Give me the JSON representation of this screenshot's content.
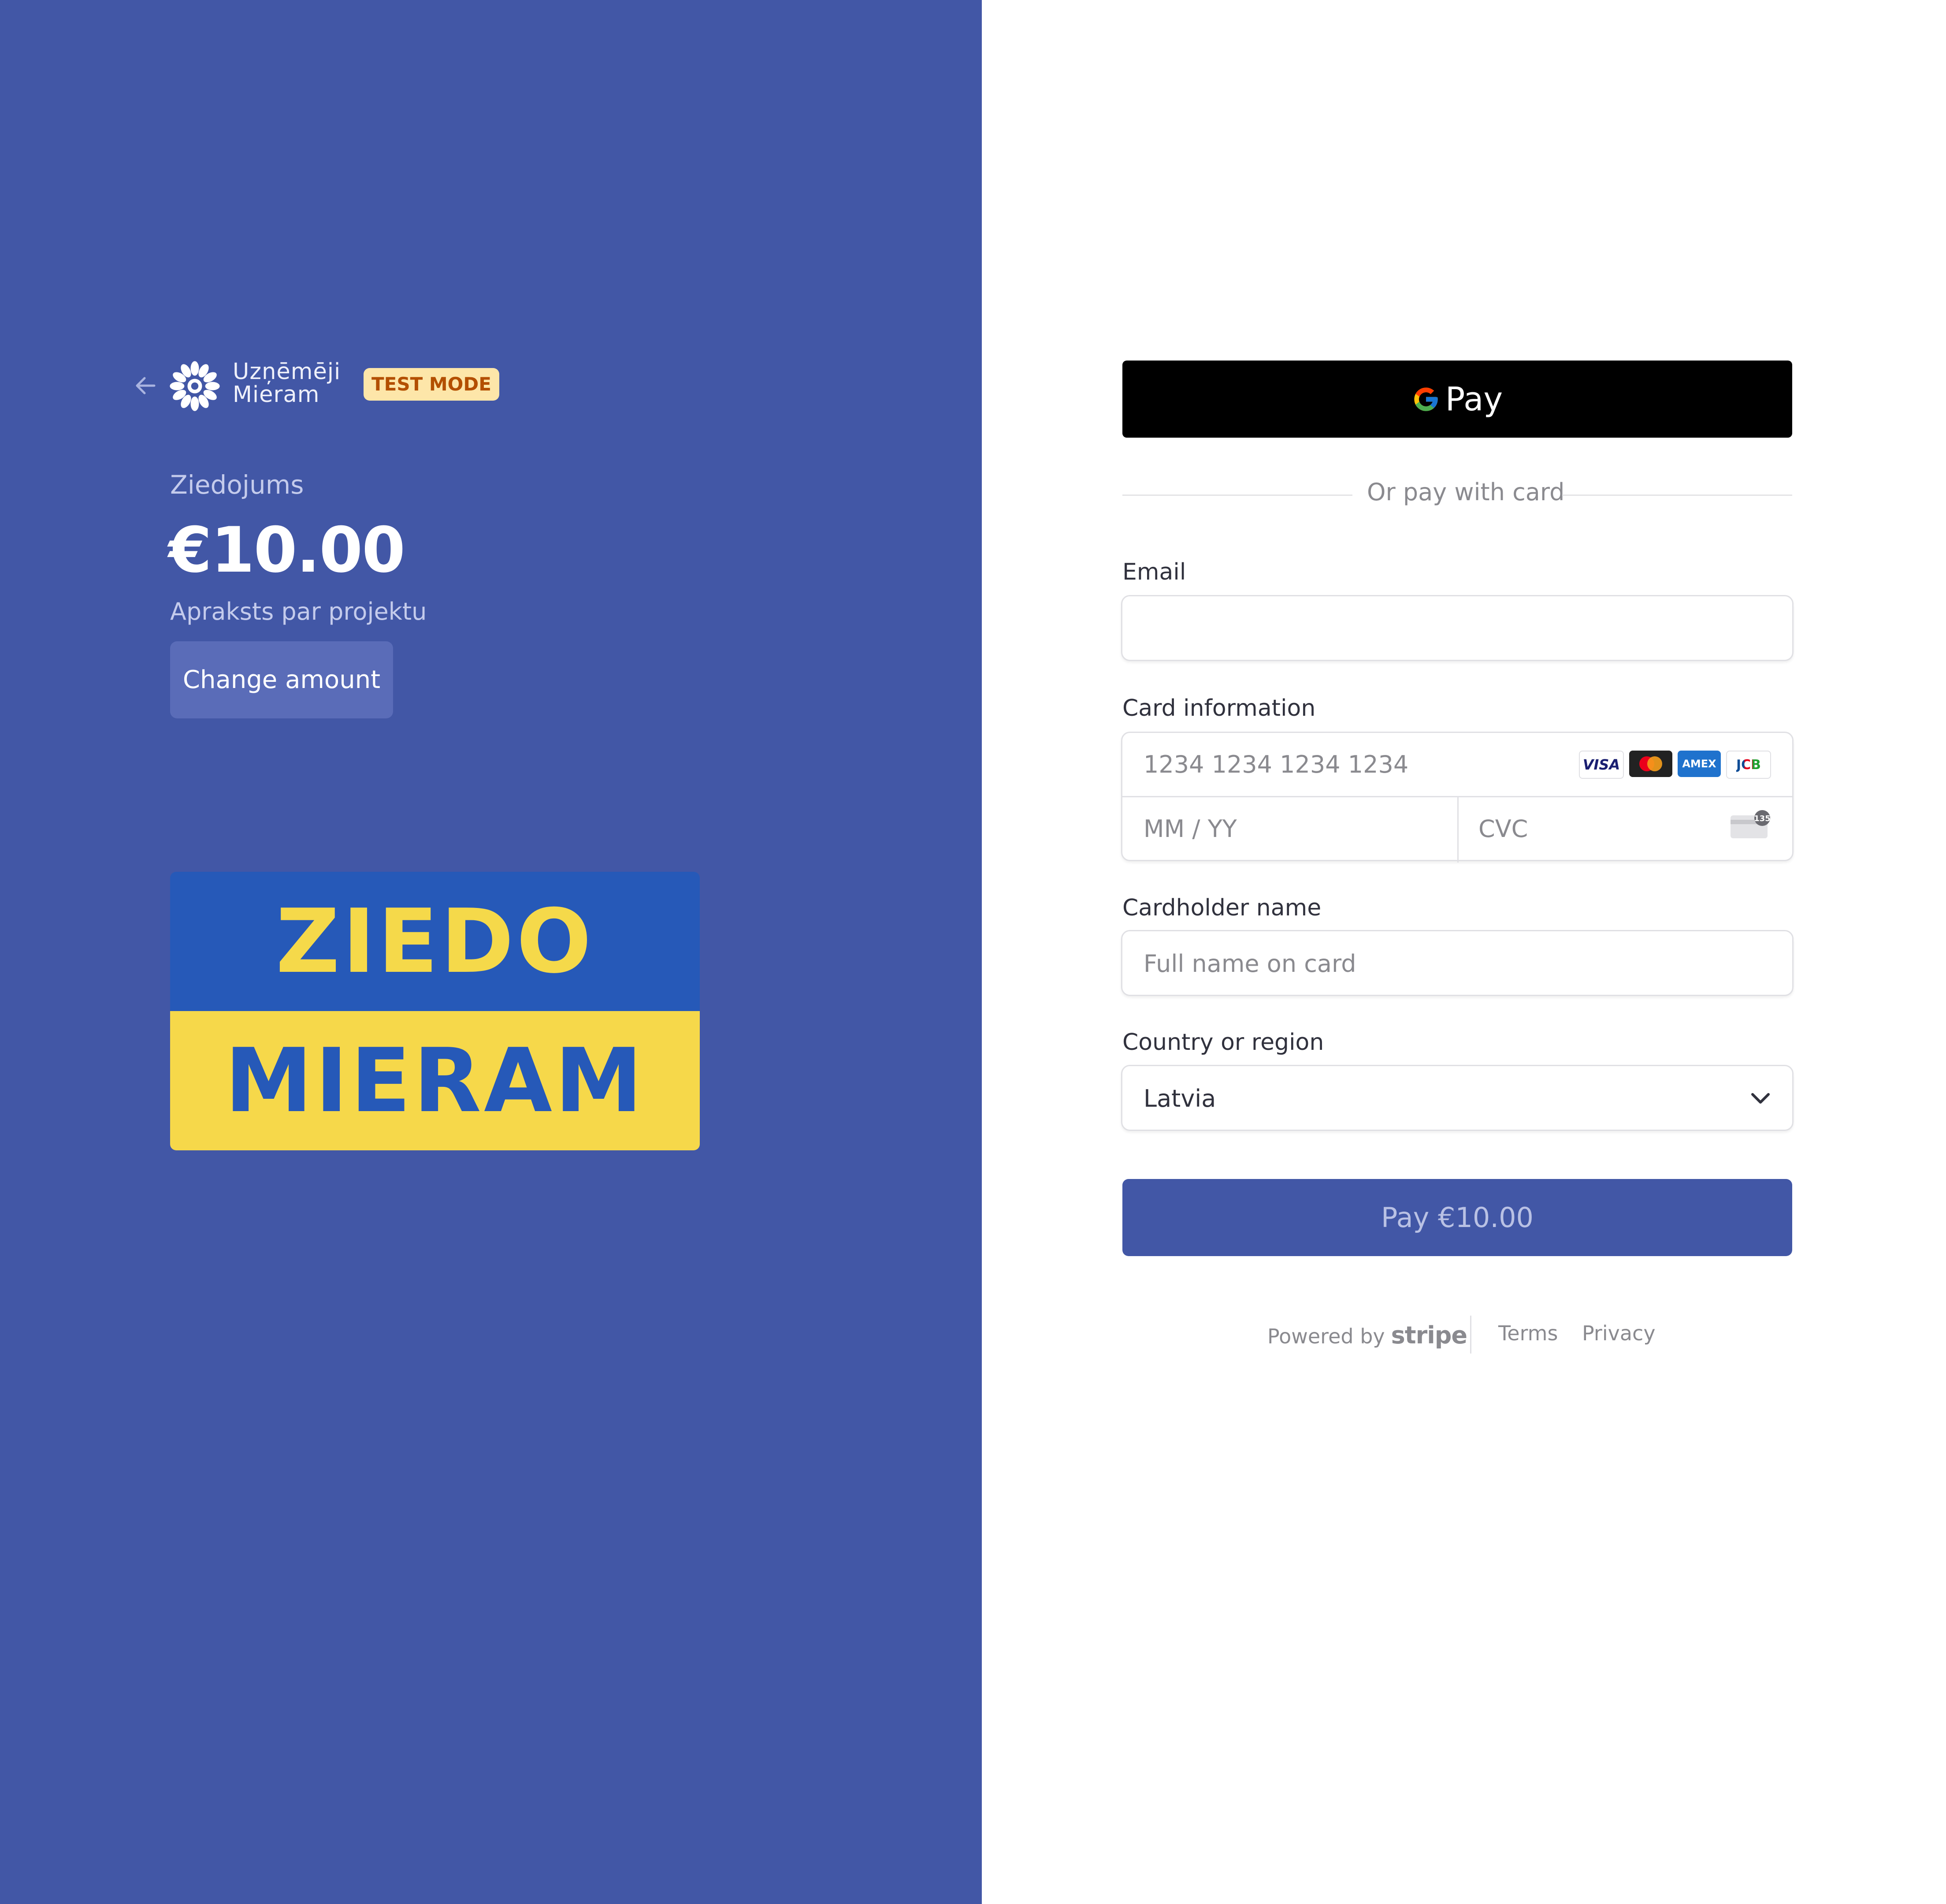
{
  "header": {
    "brand_line1": "Uzņēmēji",
    "brand_line2": "Mieram",
    "badge": "TEST MODE"
  },
  "product": {
    "name": "Ziedojums",
    "amount": "€10.00",
    "description": "Apraksts par projektu",
    "change_label": "Change amount"
  },
  "banner": {
    "top_text": "ZIEDO",
    "bottom_text": "MIERAM"
  },
  "payment": {
    "gpay_label": "Pay",
    "or_text": "Or pay with card",
    "email_label": "Email",
    "email_value": "",
    "card_label": "Card information",
    "card_number_placeholder": "1234 1234 1234 1234",
    "expiry_placeholder": "MM / YY",
    "cvc_placeholder": "CVC",
    "card_brands": [
      "VISA",
      "Mastercard",
      "AMEX",
      "JCB"
    ],
    "cvc_hint": "135",
    "name_label": "Cardholder name",
    "name_placeholder": "Full name on card",
    "country_label": "Country or region",
    "country_value": "Latvia",
    "pay_label": "Pay €10.00"
  },
  "footer": {
    "powered_by": "Powered by",
    "stripe": "stripe",
    "terms": "Terms",
    "privacy": "Privacy"
  },
  "colors": {
    "panel": "#4257a6",
    "badge_bg": "#fde6a9",
    "banner_blue": "#2659b8",
    "banner_yellow": "#f6d84a"
  }
}
